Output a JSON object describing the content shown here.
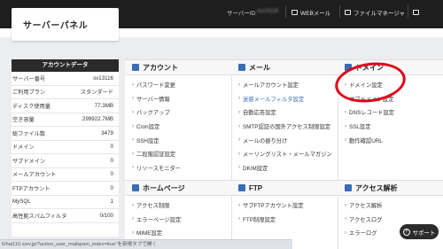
{
  "header": {
    "title": "サーバーパネル",
    "server_id_label": "サーバーID",
    "server_id_value": "sv13116",
    "webmail_label": "WEBメール",
    "filemanager_label": "ファイルマネージャ",
    "other_label": "■"
  },
  "sidebar": {
    "title": "アカウントデータ",
    "rows": [
      {
        "label": "サーバー番号",
        "value": "sv13116"
      },
      {
        "label": "ご利用プラン",
        "value": "スタンダード"
      },
      {
        "label": "ディスク使用量",
        "value": "77.3MB"
      },
      {
        "label": "空き容量",
        "value": "299922.7MB"
      },
      {
        "label": "総ファイル数",
        "value": "3479"
      },
      {
        "label": "ドメイン",
        "value": "0"
      },
      {
        "label": "サブドメイン",
        "value": "0"
      },
      {
        "label": "メールアカウント",
        "value": "0"
      },
      {
        "label": "FTPアカウント",
        "value": "0"
      },
      {
        "label": "MySQL",
        "value": "1"
      },
      {
        "label": "高性能スパムフィルタ",
        "value": "0/100"
      }
    ]
  },
  "sections": {
    "account": {
      "title": "アカウント",
      "items": [
        "パスワード変更",
        "サーバー情報",
        "バックアップ",
        "Cron設定",
        "SSH設定",
        "二段階認証設定",
        "リソースモニター"
      ]
    },
    "mail": {
      "title": "メール",
      "items": [
        "メールアカウント設定",
        "迷惑メールフィルタ設定",
        "自動応答設定",
        "SMTP認証の国外アクセス制限設定",
        "メールの振り分け",
        "メーリングリスト・メールマガジン",
        "DKIM設定"
      ]
    },
    "domain": {
      "title": "ドメイン",
      "items": [
        "ドメイン設定",
        "サブドメイン設定",
        "DNSレコード設定",
        "SSL設定",
        "動作確認URL"
      ]
    },
    "homepage": {
      "title": "ホームページ",
      "items": [
        "アクセス制限",
        "エラーページ設定",
        "MIME設定"
      ]
    },
    "ftp": {
      "title": "FTP",
      "items": [
        "サブFTPアカウント設定",
        "FTP制限設定"
      ]
    },
    "analytics": {
      "title": "アクセス解析",
      "items": [
        "アクセス解析",
        "アクセスログ",
        "エラーログ"
      ]
    }
  },
  "status_bar": "6/hai110.xsrv.jp/?action_user_mailspam_index=true\"を新規タブで開く",
  "support_label": "サポート",
  "colors": {
    "accent": "#3a6db5",
    "header_bg": "#1e1e1e",
    "annotation": "#e0001a"
  }
}
